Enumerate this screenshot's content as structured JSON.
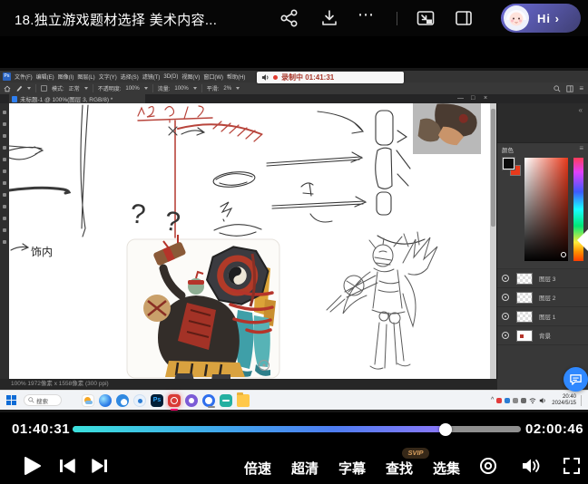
{
  "top_bar": {
    "title": "18.独立游戏题材选择 美术内容...",
    "avatar_label": "Hi ›"
  },
  "recording_overlay": {
    "label": "录制中 01:41:31"
  },
  "photoshop": {
    "menu_items": [
      "文件(F)",
      "编辑(E)",
      "图像(I)",
      "图层(L)",
      "文字(Y)",
      "选择(S)",
      "滤镜(T)",
      "3D(D)",
      "视图(V)",
      "窗口(W)",
      "帮助(H)"
    ],
    "options_bar": {
      "mode_label": "模式:",
      "mode_value": "正常",
      "opacity_label": "不透明度:",
      "opacity_value": "100%",
      "flow_label": "流量:",
      "flow_value": "100%",
      "smooth_label": "平滑:",
      "smooth_value": "2%"
    },
    "doc_tab": "未标题-1 @ 100%(图层 3, RGB/8) *",
    "status_bar": "100%   1972像素 x 1558像素 (300 ppi)",
    "color_panel": {
      "title": "颜色"
    },
    "layers_panel": {
      "layers": [
        {
          "name": "图层 3"
        },
        {
          "name": "图层 2"
        },
        {
          "name": "图层 1"
        },
        {
          "name": "背景"
        }
      ]
    }
  },
  "canvas": {
    "q1": "?",
    "q2": "?",
    "left_note": "饰内"
  },
  "taskbar": {
    "search_placeholder": "搜索",
    "clock_time": "20:40",
    "clock_date": "2024/5/15"
  },
  "player": {
    "current_time": "01:40:31",
    "total_time": "02:00:46",
    "progress_percent": 83.2,
    "buttons": {
      "speed": "倍速",
      "quality": "超清",
      "subtitles": "字幕",
      "find": "查找",
      "episodes": "选集"
    },
    "badge": "SVIP"
  },
  "icons": {
    "more": "⋯",
    "window_min": "—",
    "window_max": "□",
    "window_close": "×",
    "tray_expand": "^",
    "collapse": "«",
    "panel_menu": "≡",
    "ps_logo": "Ps"
  },
  "colors": {
    "progress_start": "#3be0dc",
    "progress_mid": "#4e7df2",
    "progress_end": "#8b78f8",
    "accent_blue": "#31a8ff",
    "fab_blue": "#2f88ff",
    "svip_gold": "#d9a05f"
  }
}
